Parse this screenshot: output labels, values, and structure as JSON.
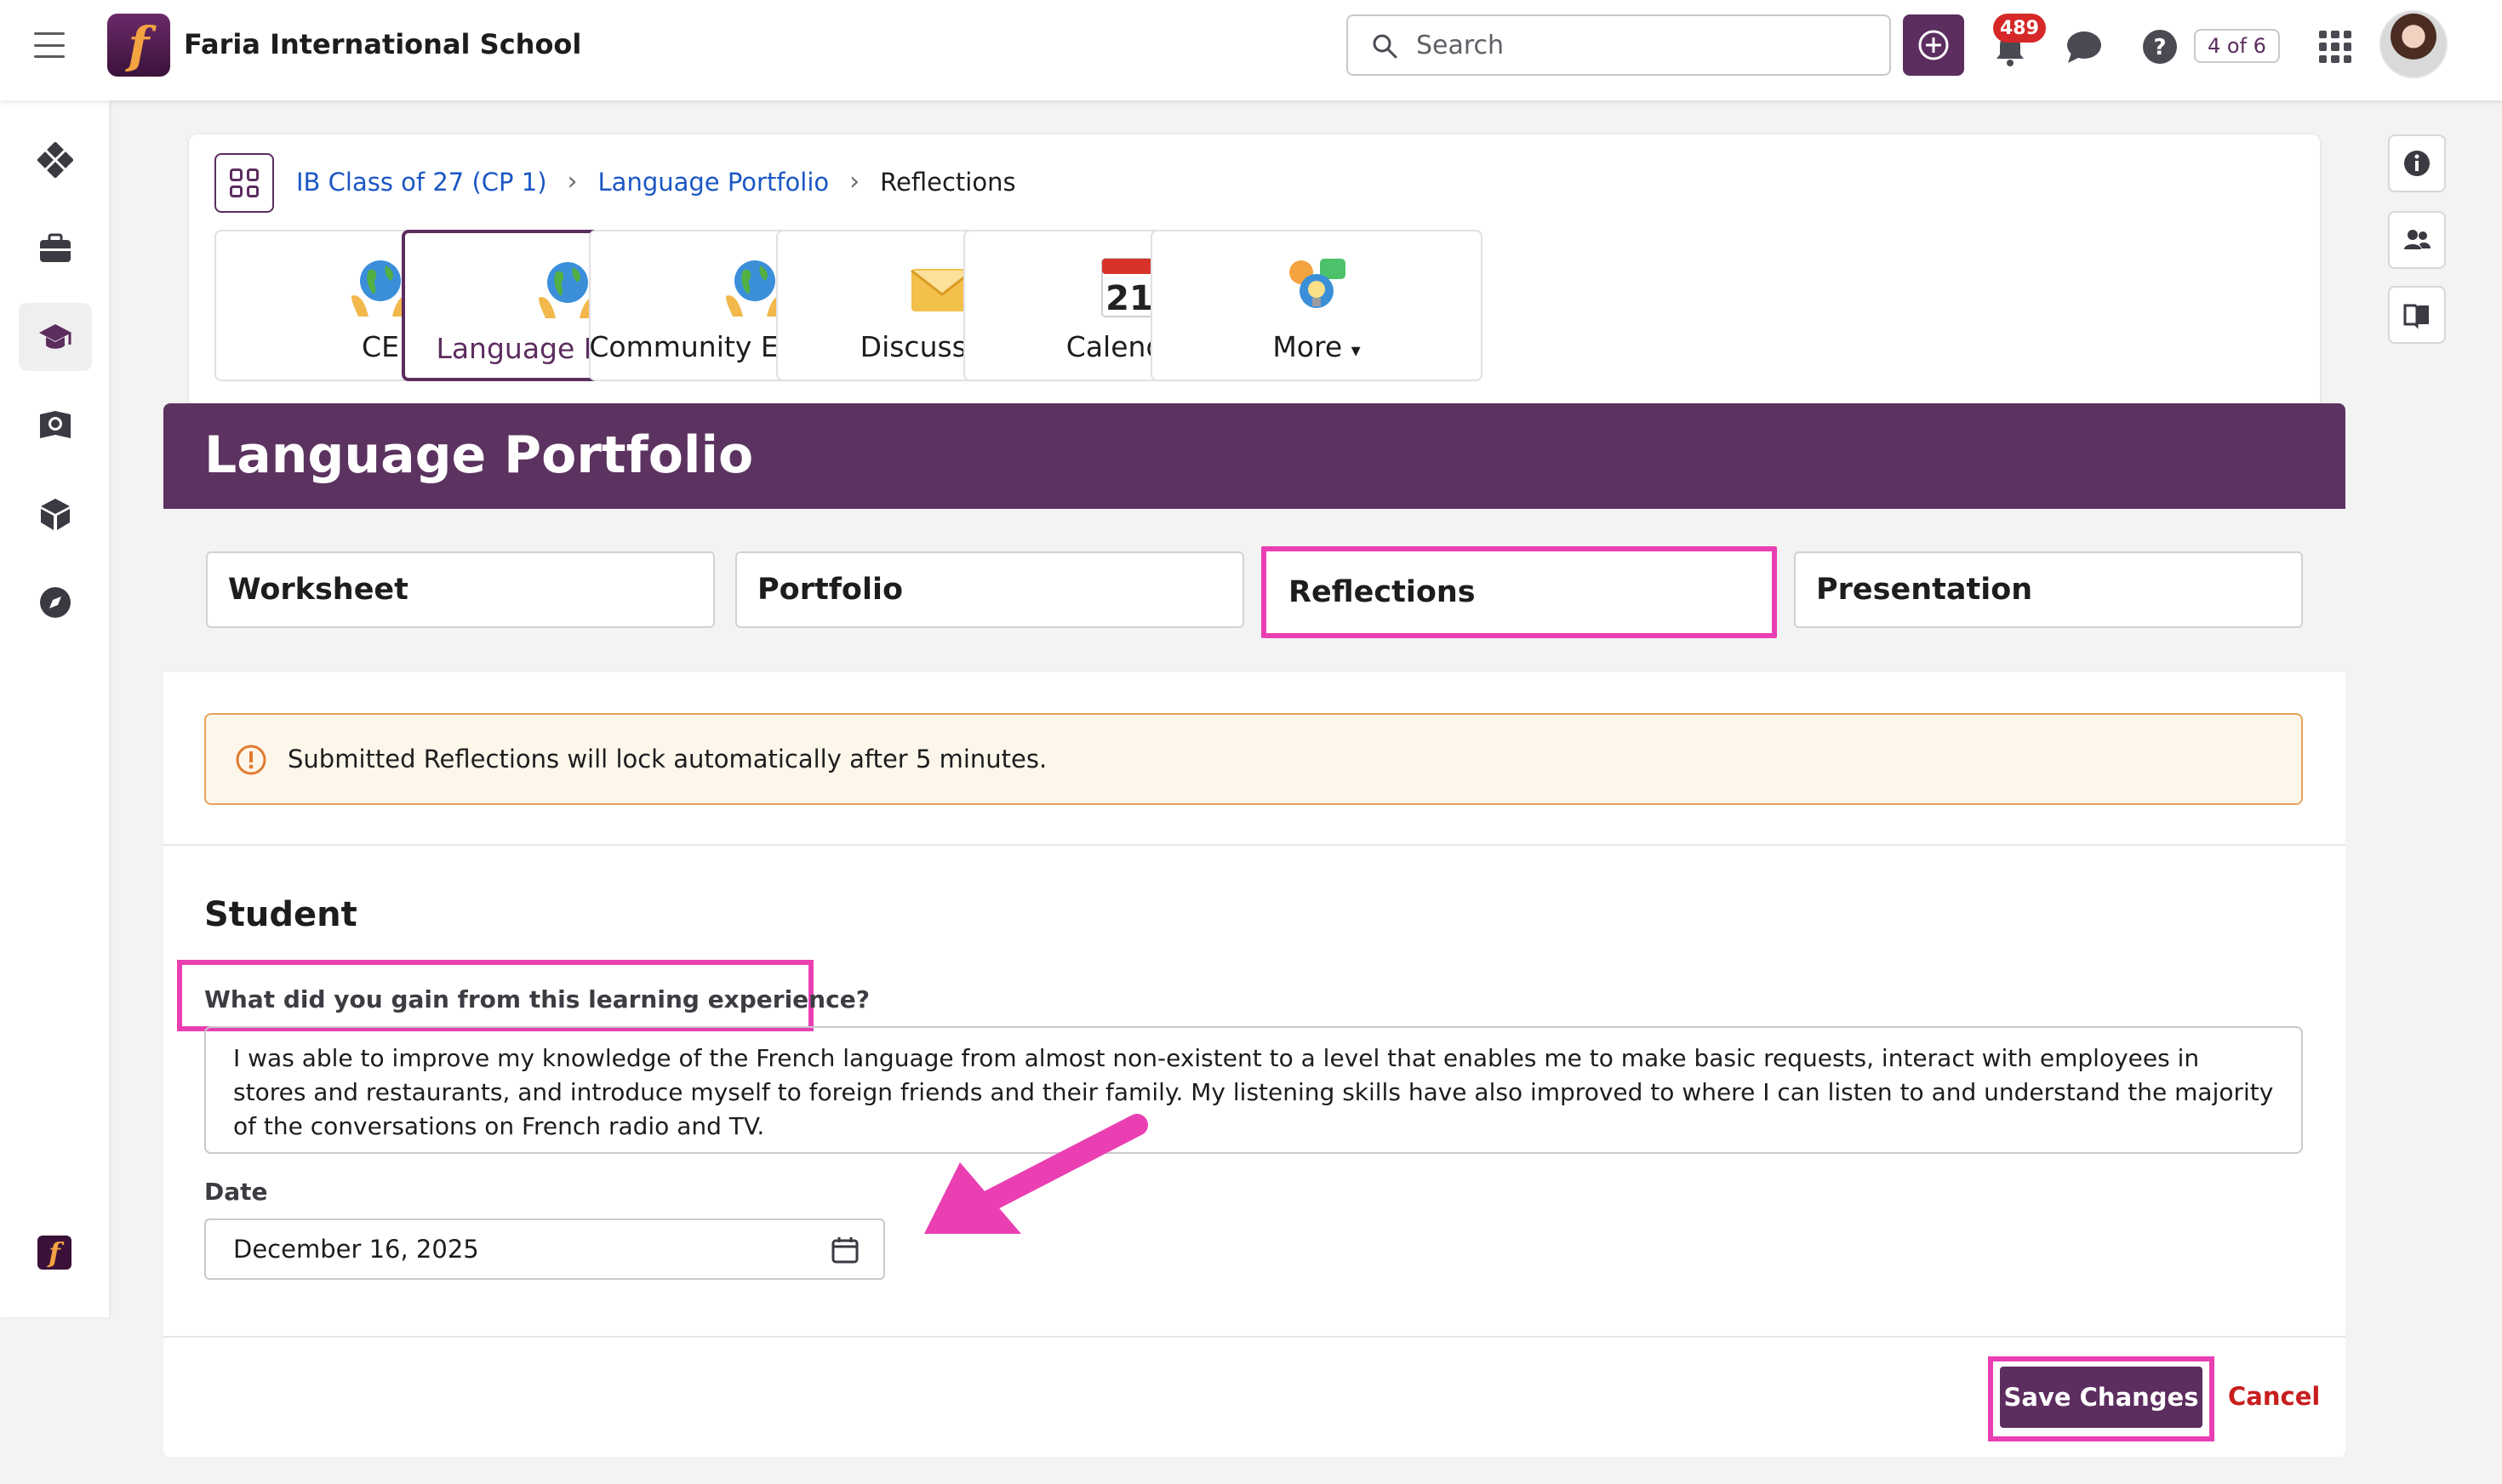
{
  "topbar": {
    "school_name": "Faria International School",
    "search_placeholder": "Search",
    "notifications_count": "489",
    "page_counter": "4 of 6"
  },
  "breadcrumb": {
    "items": [
      "IB Class of 27 (CP 1)",
      "Language Portfolio"
    ],
    "current": "Reflections"
  },
  "nav_tiles": [
    {
      "label": "CE",
      "icon": "globe-hands-icon"
    },
    {
      "label": "Language Portfolio",
      "icon": "globe-hands-icon"
    },
    {
      "label": "Community Engagem...",
      "icon": "globe-hands-icon"
    },
    {
      "label": "Discussions",
      "icon": "envelope-icon"
    },
    {
      "label": "Calendar",
      "icon": "calendar-icon",
      "date_number": "21"
    },
    {
      "label": "More",
      "icon": "ideas-icon"
    }
  ],
  "main": {
    "title": "Language Portfolio",
    "tabs": [
      "Worksheet",
      "Portfolio",
      "Reflections",
      "Presentation"
    ],
    "alert": "Submitted Reflections will lock automatically after 5 minutes.",
    "section_title": "Student",
    "question": "What did you gain from this learning experience?",
    "answer": "I was able to improve my knowledge of the French language from almost non-existent to a level that enables me to make basic requests, interact with employees in stores and restaurants, and introduce myself to foreign friends and their family.  My listening skills have also improved to where I can listen to and understand the majority of the conversations on French radio and TV.",
    "date_label": "Date",
    "date_value": "December 16, 2025",
    "save_label": "Save Changes",
    "cancel_label": "Cancel"
  },
  "colors": {
    "brand": "#5c2d5f",
    "header": "#5c3360",
    "highlight": "#ea3fb2",
    "link": "#1b57c4",
    "cancel": "#c81e1e",
    "alert_border": "#e5a25d"
  }
}
